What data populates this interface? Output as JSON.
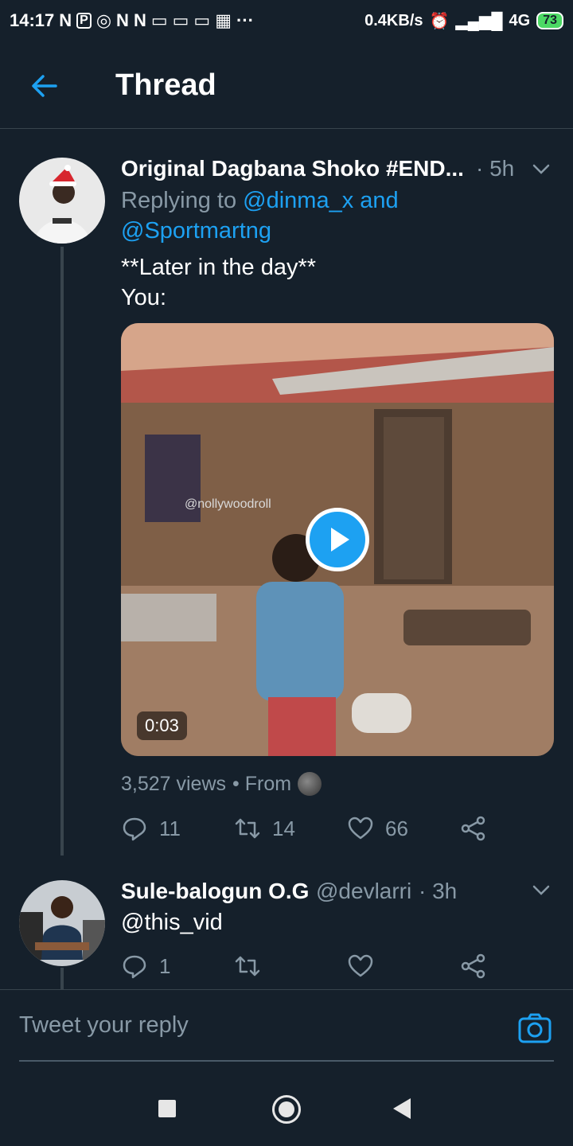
{
  "status_bar": {
    "time": "14:17",
    "left_glyphs": [
      "N",
      "P",
      "◎",
      "N",
      "N",
      "▭",
      "▭",
      "▭",
      "▦",
      "···"
    ],
    "network_speed": "0.4KB/s",
    "network_type": "4G",
    "battery": "73"
  },
  "header": {
    "title": "Thread"
  },
  "tweets": [
    {
      "name": "Original Dagbana Shoko #END...",
      "time": "· 5h",
      "replying_prefix": "Replying to",
      "replying_to_1": "@dinma_x",
      "replying_and": "and",
      "replying_to_2": "@Sportmartng",
      "text_line1": "**Later in the day**",
      "text_line2": "You:",
      "media": {
        "type": "video",
        "watermark": "@nollywoodroll",
        "duration": "0:03"
      },
      "views": "3,527 views",
      "source": "• From",
      "replies": "11",
      "retweets": "14",
      "likes": "66"
    },
    {
      "name": "Sule-balogun O.G",
      "handle": "@devlarri",
      "time": "· 3h",
      "text": "@this_vid",
      "replies": "1",
      "retweets": "",
      "likes": ""
    }
  ],
  "reply_box": {
    "placeholder": "Tweet your reply"
  },
  "colors": {
    "background": "#15202b",
    "accent": "#1da1f2",
    "muted": "#8899a6",
    "divider": "#38444d"
  },
  "icons": [
    "back-arrow-icon",
    "chevron-down-icon",
    "reply-icon",
    "retweet-icon",
    "like-icon",
    "share-icon",
    "camera-icon",
    "play-icon"
  ]
}
